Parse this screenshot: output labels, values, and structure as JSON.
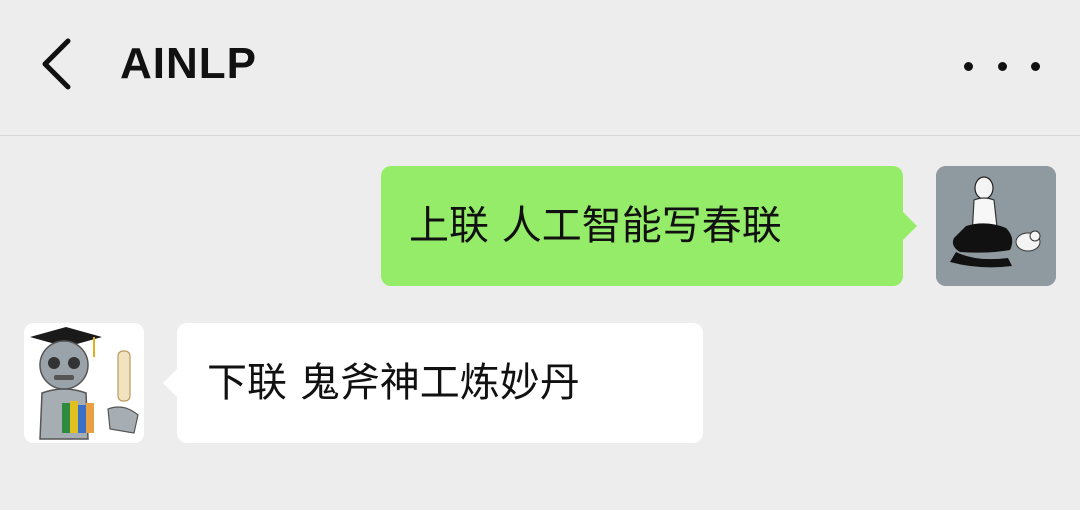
{
  "header": {
    "title": "AINLP",
    "back_icon": "chevron-left-icon",
    "more_icon": "more-horizontal-icon"
  },
  "messages": [
    {
      "sender": "me",
      "text": "上联 人工智能写春联",
      "bubble_color": "#95ec69"
    },
    {
      "sender": "bot",
      "text": "下联 鬼斧神工炼妙丹",
      "bubble_color": "#ffffff"
    }
  ],
  "colors": {
    "background": "#ededed",
    "sent_bubble": "#95ec69",
    "received_bubble": "#ffffff"
  }
}
